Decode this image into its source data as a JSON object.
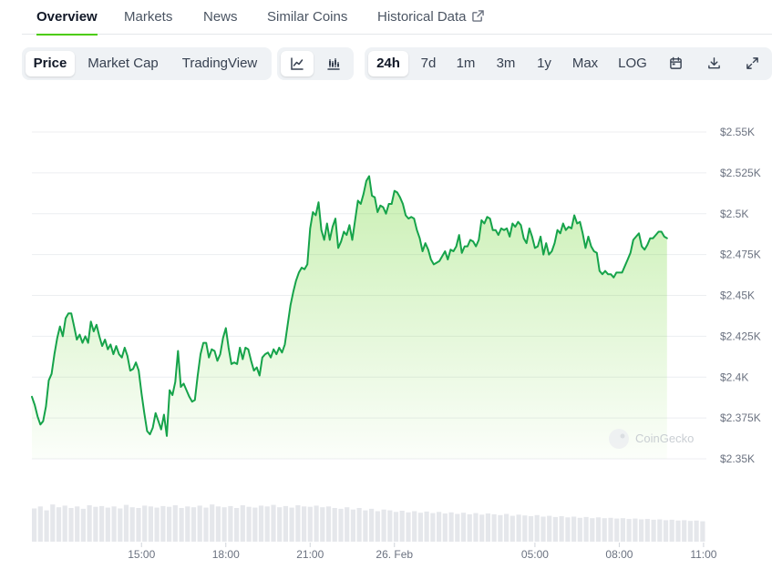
{
  "tabs": [
    {
      "label": "Overview",
      "active": true
    },
    {
      "label": "Markets"
    },
    {
      "label": "News"
    },
    {
      "label": "Similar Coins"
    },
    {
      "label": "Historical Data"
    }
  ],
  "chart_modes": [
    {
      "label": "Price",
      "active": true
    },
    {
      "label": "Market Cap"
    },
    {
      "label": "TradingView"
    }
  ],
  "chart_styles": [
    {
      "icon": "line-chart-icon",
      "active": true
    },
    {
      "icon": "candlestick-chart-icon"
    }
  ],
  "time_ranges": [
    {
      "label": "24h",
      "active": true
    },
    {
      "label": "7d"
    },
    {
      "label": "1m"
    },
    {
      "label": "3m"
    },
    {
      "label": "1y"
    },
    {
      "label": "Max"
    },
    {
      "label": "LOG"
    }
  ],
  "tool_icons": [
    "calendar-icon",
    "download-icon",
    "fullscreen-icon"
  ],
  "watermark": "CoinGecko",
  "colors": {
    "line": "#16a34a",
    "fill": "#4bcc00",
    "accent": "#4bcc00",
    "volume": "#e5e7eb"
  },
  "chart_data": {
    "type": "line",
    "y_ticks": [
      {
        "value": 2.35,
        "label": "$2.35K"
      },
      {
        "value": 2.375,
        "label": "$2.375K"
      },
      {
        "value": 2.4,
        "label": "$2.4K"
      },
      {
        "value": 2.425,
        "label": "$2.425K"
      },
      {
        "value": 2.45,
        "label": "$2.45K"
      },
      {
        "value": 2.475,
        "label": "$2.475K"
      },
      {
        "value": 2.5,
        "label": "$2.5K"
      },
      {
        "value": 2.525,
        "label": "$2.525K"
      },
      {
        "value": 2.55,
        "label": "$2.55K"
      }
    ],
    "ylim": [
      2.35,
      2.55
    ],
    "x_ticks": [
      {
        "value": 15.0,
        "label": "15:00"
      },
      {
        "value": 18.0,
        "label": "18:00"
      },
      {
        "value": 21.0,
        "label": "21:00"
      },
      {
        "value": 24.0,
        "label": "26. Feb"
      },
      {
        "value": 29.0,
        "label": "05:00"
      },
      {
        "value": 32.0,
        "label": "08:00"
      },
      {
        "value": 35.0,
        "label": "11:00"
      }
    ],
    "xlim": [
      11.1,
      35.1
    ],
    "series": [
      {
        "values": [
          [
            11.1,
            2.388
          ],
          [
            11.2,
            2.383
          ],
          [
            11.3,
            2.376
          ],
          [
            11.4,
            2.371
          ],
          [
            11.5,
            2.373
          ],
          [
            11.6,
            2.382
          ],
          [
            11.7,
            2.398
          ],
          [
            11.8,
            2.402
          ],
          [
            11.9,
            2.414
          ],
          [
            12.0,
            2.424
          ],
          [
            12.1,
            2.431
          ],
          [
            12.2,
            2.425
          ],
          [
            12.3,
            2.436
          ],
          [
            12.4,
            2.439
          ],
          [
            12.5,
            2.439
          ],
          [
            12.6,
            2.431
          ],
          [
            12.7,
            2.423
          ],
          [
            12.8,
            2.426
          ],
          [
            12.9,
            2.421
          ],
          [
            13.0,
            2.425
          ],
          [
            13.1,
            2.421
          ],
          [
            13.2,
            2.434
          ],
          [
            13.3,
            2.428
          ],
          [
            13.4,
            2.432
          ],
          [
            13.5,
            2.425
          ],
          [
            13.6,
            2.419
          ],
          [
            13.7,
            2.423
          ],
          [
            13.8,
            2.417
          ],
          [
            13.9,
            2.42
          ],
          [
            14.0,
            2.414
          ],
          [
            14.1,
            2.419
          ],
          [
            14.2,
            2.414
          ],
          [
            14.3,
            2.412
          ],
          [
            14.4,
            2.418
          ],
          [
            14.5,
            2.413
          ],
          [
            14.6,
            2.404
          ],
          [
            14.7,
            2.405
          ],
          [
            14.8,
            2.409
          ],
          [
            14.9,
            2.404
          ],
          [
            15.0,
            2.39
          ],
          [
            15.1,
            2.378
          ],
          [
            15.2,
            2.367
          ],
          [
            15.3,
            2.365
          ],
          [
            15.4,
            2.369
          ],
          [
            15.5,
            2.378
          ],
          [
            15.6,
            2.373
          ],
          [
            15.7,
            2.368
          ],
          [
            15.8,
            2.377
          ],
          [
            15.9,
            2.364
          ],
          [
            16.0,
            2.392
          ],
          [
            16.1,
            2.389
          ],
          [
            16.2,
            2.397
          ],
          [
            16.3,
            2.416
          ],
          [
            16.4,
            2.394
          ],
          [
            16.5,
            2.396
          ],
          [
            16.6,
            2.392
          ],
          [
            16.7,
            2.388
          ],
          [
            16.8,
            2.385
          ],
          [
            16.9,
            2.386
          ],
          [
            17.0,
            2.401
          ],
          [
            17.1,
            2.414
          ],
          [
            17.2,
            2.421
          ],
          [
            17.3,
            2.421
          ],
          [
            17.4,
            2.412
          ],
          [
            17.5,
            2.417
          ],
          [
            17.6,
            2.416
          ],
          [
            17.7,
            2.41
          ],
          [
            17.8,
            2.414
          ],
          [
            17.9,
            2.424
          ],
          [
            18.0,
            2.43
          ],
          [
            18.1,
            2.418
          ],
          [
            18.2,
            2.408
          ],
          [
            18.3,
            2.409
          ],
          [
            18.4,
            2.408
          ],
          [
            18.5,
            2.418
          ],
          [
            18.6,
            2.411
          ],
          [
            18.7,
            2.418
          ],
          [
            18.8,
            2.417
          ],
          [
            18.9,
            2.41
          ],
          [
            19.0,
            2.404
          ],
          [
            19.1,
            2.406
          ],
          [
            19.2,
            2.401
          ],
          [
            19.3,
            2.412
          ],
          [
            19.4,
            2.414
          ],
          [
            19.5,
            2.415
          ],
          [
            19.6,
            2.412
          ],
          [
            19.7,
            2.417
          ],
          [
            19.8,
            2.414
          ],
          [
            19.9,
            2.418
          ],
          [
            20.0,
            2.415
          ],
          [
            20.1,
            2.42
          ],
          [
            20.2,
            2.432
          ],
          [
            20.3,
            2.444
          ],
          [
            20.4,
            2.452
          ],
          [
            20.5,
            2.459
          ],
          [
            20.6,
            2.464
          ],
          [
            20.7,
            2.467
          ],
          [
            20.8,
            2.466
          ],
          [
            20.9,
            2.469
          ],
          [
            21.0,
            2.491
          ],
          [
            21.1,
            2.501
          ],
          [
            21.2,
            2.499
          ],
          [
            21.3,
            2.507
          ],
          [
            21.4,
            2.49
          ],
          [
            21.5,
            2.484
          ],
          [
            21.6,
            2.494
          ],
          [
            21.7,
            2.484
          ],
          [
            21.8,
            2.492
          ],
          [
            21.9,
            2.497
          ],
          [
            22.0,
            2.479
          ],
          [
            22.1,
            2.483
          ],
          [
            22.2,
            2.489
          ],
          [
            22.3,
            2.487
          ],
          [
            22.4,
            2.493
          ],
          [
            22.5,
            2.484
          ],
          [
            22.6,
            2.496
          ],
          [
            22.7,
            2.508
          ],
          [
            22.8,
            2.506
          ],
          [
            22.9,
            2.512
          ],
          [
            23.0,
            2.52
          ],
          [
            23.1,
            2.523
          ],
          [
            23.2,
            2.511
          ],
          [
            23.3,
            2.51
          ],
          [
            23.4,
            2.501
          ],
          [
            23.5,
            2.505
          ],
          [
            23.6,
            2.504
          ],
          [
            23.7,
            2.5
          ],
          [
            23.8,
            2.506
          ],
          [
            23.9,
            2.506
          ],
          [
            24.0,
            2.514
          ],
          [
            24.1,
            2.513
          ],
          [
            24.2,
            2.51
          ],
          [
            24.3,
            2.506
          ],
          [
            24.4,
            2.499
          ],
          [
            24.5,
            2.497
          ],
          [
            24.6,
            2.498
          ],
          [
            24.7,
            2.497
          ],
          [
            24.8,
            2.49
          ],
          [
            24.9,
            2.485
          ],
          [
            25.0,
            2.477
          ],
          [
            25.1,
            2.482
          ],
          [
            25.2,
            2.478
          ],
          [
            25.3,
            2.472
          ],
          [
            25.4,
            2.469
          ],
          [
            25.5,
            2.47
          ],
          [
            25.6,
            2.471
          ],
          [
            25.7,
            2.474
          ],
          [
            25.8,
            2.477
          ],
          [
            25.9,
            2.472
          ],
          [
            26.0,
            2.478
          ],
          [
            26.1,
            2.477
          ],
          [
            26.2,
            2.48
          ],
          [
            26.3,
            2.487
          ],
          [
            26.4,
            2.476
          ],
          [
            26.5,
            2.48
          ],
          [
            26.6,
            2.48
          ],
          [
            26.7,
            2.484
          ],
          [
            26.8,
            2.483
          ],
          [
            26.9,
            2.48
          ],
          [
            27.0,
            2.484
          ],
          [
            27.1,
            2.496
          ],
          [
            27.2,
            2.494
          ],
          [
            27.3,
            2.498
          ],
          [
            27.4,
            2.497
          ],
          [
            27.5,
            2.49
          ],
          [
            27.6,
            2.49
          ],
          [
            27.7,
            2.487
          ],
          [
            27.8,
            2.491
          ],
          [
            27.9,
            2.49
          ],
          [
            28.0,
            2.491
          ],
          [
            28.1,
            2.486
          ],
          [
            28.2,
            2.494
          ],
          [
            28.3,
            2.492
          ],
          [
            28.4,
            2.495
          ],
          [
            28.5,
            2.493
          ],
          [
            28.6,
            2.485
          ],
          [
            28.7,
            2.482
          ],
          [
            28.8,
            2.491
          ],
          [
            28.9,
            2.486
          ],
          [
            29.0,
            2.479
          ],
          [
            29.1,
            2.48
          ],
          [
            29.2,
            2.486
          ],
          [
            29.3,
            2.475
          ],
          [
            29.4,
            2.482
          ],
          [
            29.5,
            2.475
          ],
          [
            29.6,
            2.477
          ],
          [
            29.7,
            2.482
          ],
          [
            29.8,
            2.49
          ],
          [
            29.9,
            2.488
          ],
          [
            30.0,
            2.494
          ],
          [
            30.1,
            2.49
          ],
          [
            30.2,
            2.492
          ],
          [
            30.3,
            2.491
          ],
          [
            30.4,
            2.499
          ],
          [
            30.5,
            2.494
          ],
          [
            30.6,
            2.495
          ],
          [
            30.7,
            2.488
          ],
          [
            30.8,
            2.479
          ],
          [
            30.9,
            2.486
          ],
          [
            31.0,
            2.48
          ],
          [
            31.1,
            2.477
          ],
          [
            31.2,
            2.476
          ],
          [
            31.3,
            2.465
          ],
          [
            31.4,
            2.463
          ],
          [
            31.5,
            2.465
          ],
          [
            31.6,
            2.463
          ],
          [
            31.7,
            2.463
          ],
          [
            31.8,
            2.461
          ],
          [
            31.9,
            2.464
          ],
          [
            32.0,
            2.464
          ],
          [
            32.1,
            2.464
          ],
          [
            32.2,
            2.468
          ],
          [
            32.3,
            2.472
          ],
          [
            32.4,
            2.476
          ],
          [
            32.5,
            2.484
          ],
          [
            32.6,
            2.486
          ],
          [
            32.7,
            2.488
          ],
          [
            32.8,
            2.48
          ],
          [
            32.9,
            2.478
          ],
          [
            33.0,
            2.481
          ],
          [
            33.1,
            2.485
          ],
          [
            33.2,
            2.485
          ],
          [
            33.3,
            2.487
          ],
          [
            33.4,
            2.489
          ],
          [
            33.5,
            2.489
          ],
          [
            33.6,
            2.486
          ],
          [
            33.7,
            2.485
          ]
        ]
      }
    ],
    "volume_relative": [
      0.85,
      0.9,
      0.8,
      0.95,
      0.88,
      0.92,
      0.86,
      0.9,
      0.84,
      0.93,
      0.89,
      0.91,
      0.87,
      0.9,
      0.85,
      0.94,
      0.88,
      0.86,
      0.92,
      0.9,
      0.87,
      0.91,
      0.89,
      0.93,
      0.86,
      0.9,
      0.88,
      0.92,
      0.87,
      0.95,
      0.9,
      0.88,
      0.91,
      0.86,
      0.93,
      0.89,
      0.87,
      0.92,
      0.9,
      0.94,
      0.88,
      0.91,
      0.87,
      0.93,
      0.9,
      0.89,
      0.92,
      0.88,
      0.9,
      0.86,
      0.84,
      0.88,
      0.82,
      0.86,
      0.8,
      0.84,
      0.78,
      0.82,
      0.8,
      0.76,
      0.79,
      0.75,
      0.78,
      0.74,
      0.77,
      0.73,
      0.76,
      0.72,
      0.75,
      0.71,
      0.74,
      0.7,
      0.73,
      0.69,
      0.72,
      0.7,
      0.68,
      0.71,
      0.66,
      0.69,
      0.67,
      0.65,
      0.68,
      0.64,
      0.66,
      0.63,
      0.65,
      0.62,
      0.64,
      0.61,
      0.63,
      0.6,
      0.62,
      0.6,
      0.61,
      0.59,
      0.6,
      0.58,
      0.59,
      0.57,
      0.58,
      0.56,
      0.57,
      0.55,
      0.56,
      0.54,
      0.55,
      0.53,
      0.54,
      0.52
    ],
    "grid": true,
    "legend": "none"
  }
}
